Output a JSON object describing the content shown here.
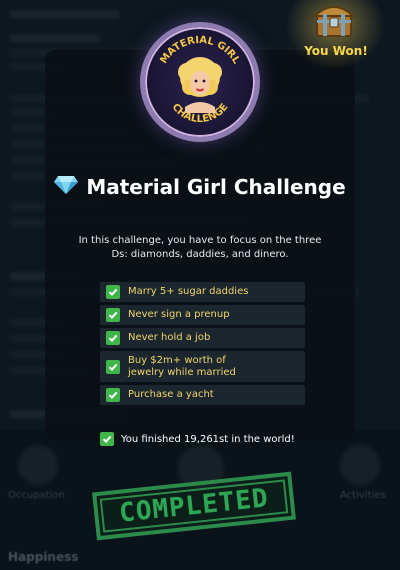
{
  "reward": {
    "label": "You Won!"
  },
  "badge": {
    "top_text": "MATERIAL GIRL",
    "bottom_text": "CHALLENGE"
  },
  "challenge": {
    "icon": "diamond-icon",
    "title": "Material Girl Challenge",
    "description": "In this challenge, you have to focus on the three Ds: diamonds, daddies, and dinero."
  },
  "tasks": [
    {
      "label": "Marry 5+ sugar daddies",
      "done": true
    },
    {
      "label": "Never sign a prenup",
      "done": true
    },
    {
      "label": "Never hold a job",
      "done": true
    },
    {
      "label": "Buy $2m+ worth of jewelry while married",
      "done": true
    },
    {
      "label": "Purchase a yacht",
      "done": true
    }
  ],
  "result": {
    "label": "You finished 19,261st in the world!"
  },
  "stamp": {
    "label": "COMPLETED"
  },
  "background": {
    "footer_labels": [
      "Occupation",
      "Activities"
    ],
    "happiness_label": "Happiness"
  },
  "colors": {
    "accent_gold": "#f1d56c",
    "check_green": "#3fb54a",
    "stamp_green": "#2fa556",
    "modal_bg": "#0a1016"
  }
}
